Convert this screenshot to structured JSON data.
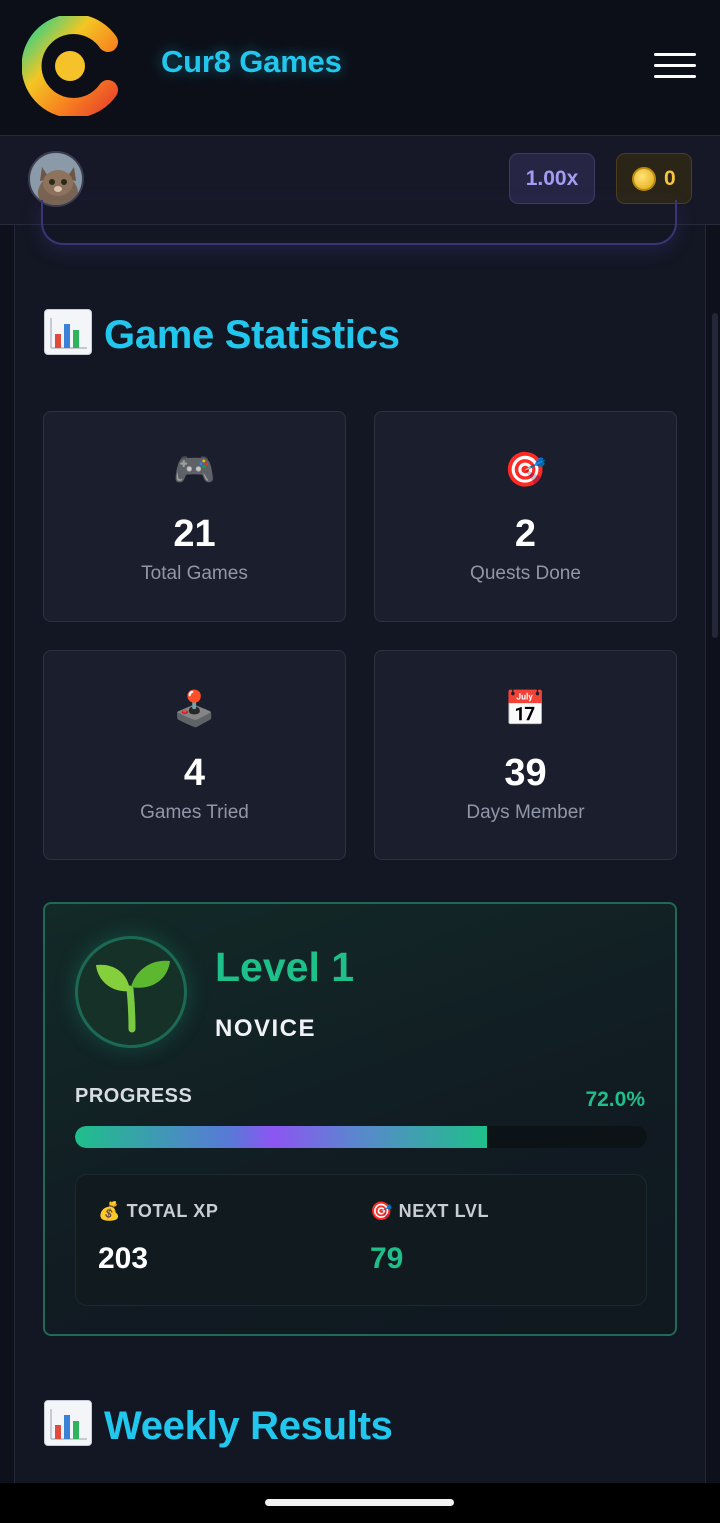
{
  "header": {
    "brand": "Cur8 Games",
    "logo_icon": "cur8-logo-icon",
    "menu_icon": "hamburger-menu-icon"
  },
  "userbar": {
    "avatar_icon": "cat-avatar-icon",
    "multiplier": "1.00x",
    "coin_icon": "coin-icon",
    "coins": "0"
  },
  "stats": {
    "title": "Game Statistics",
    "title_icon": "bar-chart-icon",
    "cards": [
      {
        "icon": "🎮",
        "icon_name": "game-controller-icon",
        "value": "21",
        "label": "Total Games"
      },
      {
        "icon": "🎯",
        "icon_name": "target-icon",
        "value": "2",
        "label": "Quests Done"
      },
      {
        "icon": "🕹️",
        "icon_name": "joystick-icon",
        "value": "4",
        "label": "Games Tried"
      },
      {
        "icon": "📅",
        "icon_name": "calendar-icon",
        "value": "39",
        "label": "Days Member"
      }
    ]
  },
  "level": {
    "icon": "🌱",
    "icon_name": "sprout-icon",
    "title": "Level 1",
    "rank": "NOVICE",
    "progress_label": "PROGRESS",
    "progress_text": "72.0%",
    "progress_fraction": 0.72,
    "total_xp_icon": "💰",
    "total_xp_label": "TOTAL XP",
    "total_xp_value": "203",
    "next_lvl_icon": "🎯",
    "next_lvl_label": "NEXT LVL",
    "next_lvl_value": "79"
  },
  "weekly": {
    "title": "Weekly Results",
    "title_icon": "bar-chart-icon"
  },
  "colors": {
    "accent_cyan": "#22c7ee",
    "level_green": "#1fbf8a",
    "multiplier_purple": "#a29cf2",
    "coin_gold": "#f6c53d"
  }
}
